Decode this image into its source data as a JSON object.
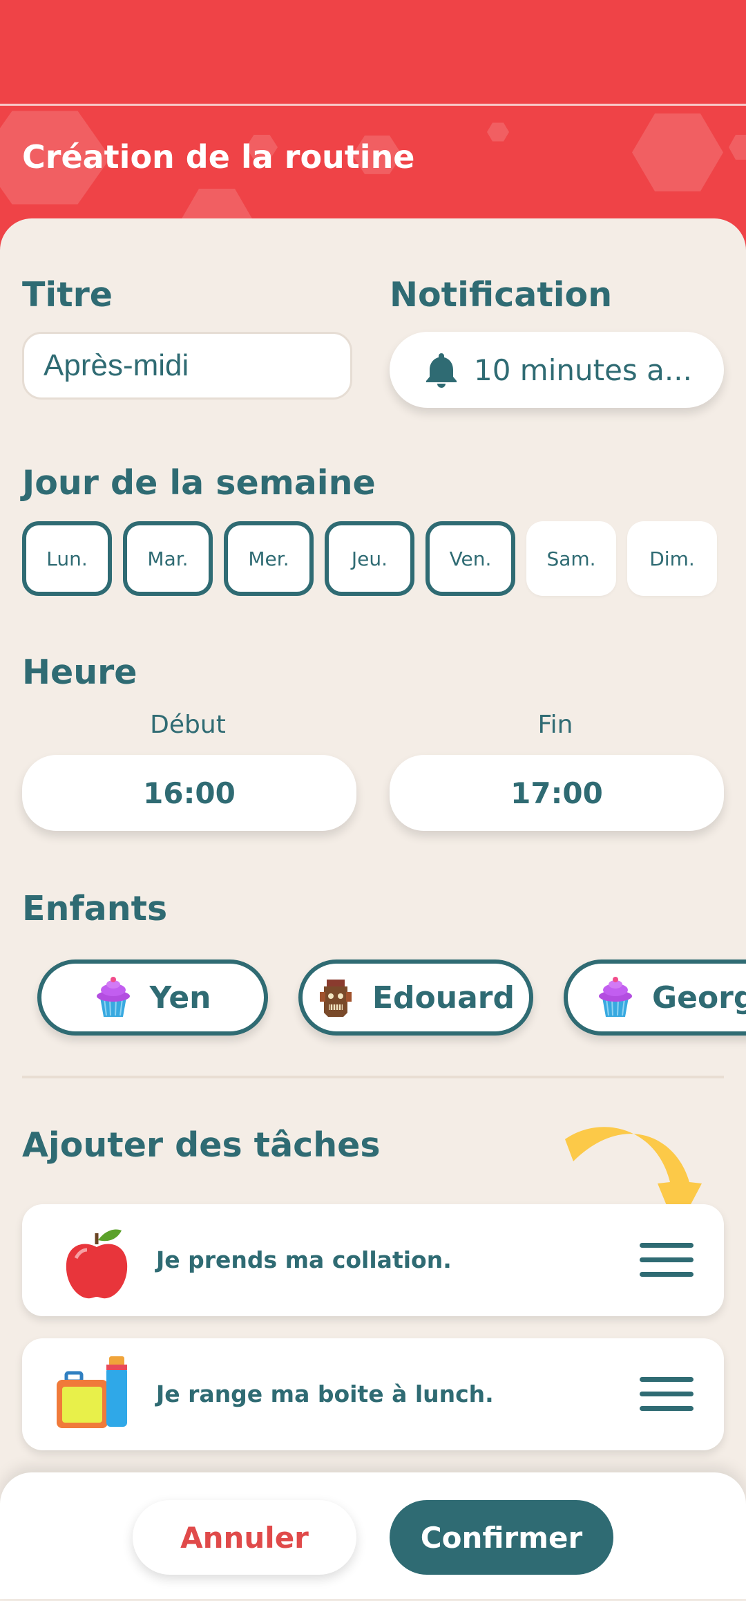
{
  "colors": {
    "brand_red": "#ef4347",
    "teal": "#2f6b73",
    "background": "#f4ede6",
    "cancel_text": "#e04a4a",
    "arrow": "#fcc948"
  },
  "header": {
    "title": "Création de la routine"
  },
  "form": {
    "title_label": "Titre",
    "title_value": "Après-midi",
    "notification_label": "Notification",
    "notification_icon": "bell-icon",
    "notification_value": "10 minutes a...",
    "days_label": "Jour de la semaine",
    "days": [
      {
        "label": "Lun.",
        "selected": true
      },
      {
        "label": "Mar.",
        "selected": true
      },
      {
        "label": "Mer.",
        "selected": true
      },
      {
        "label": "Jeu.",
        "selected": true
      },
      {
        "label": "Ven.",
        "selected": true
      },
      {
        "label": "Sam.",
        "selected": false
      },
      {
        "label": "Dim.",
        "selected": false
      }
    ],
    "time_label": "Heure",
    "start_label": "Début",
    "start_value": "16:00",
    "end_label": "Fin",
    "end_value": "17:00",
    "children_label": "Enfants",
    "children": [
      {
        "name": "Yen",
        "avatar": "cupcake-icon"
      },
      {
        "name": "Edouard",
        "avatar": "totem-icon"
      },
      {
        "name": "George",
        "avatar": "cupcake-icon"
      }
    ],
    "tasks_label": "Ajouter des tâches",
    "tasks": [
      {
        "label": "Je prends ma collation.",
        "icon": "apple-icon"
      },
      {
        "label": "Je range ma boite à lunch.",
        "icon": "lunchbox-icon"
      }
    ]
  },
  "footer": {
    "cancel_label": "Annuler",
    "confirm_label": "Confirmer"
  }
}
